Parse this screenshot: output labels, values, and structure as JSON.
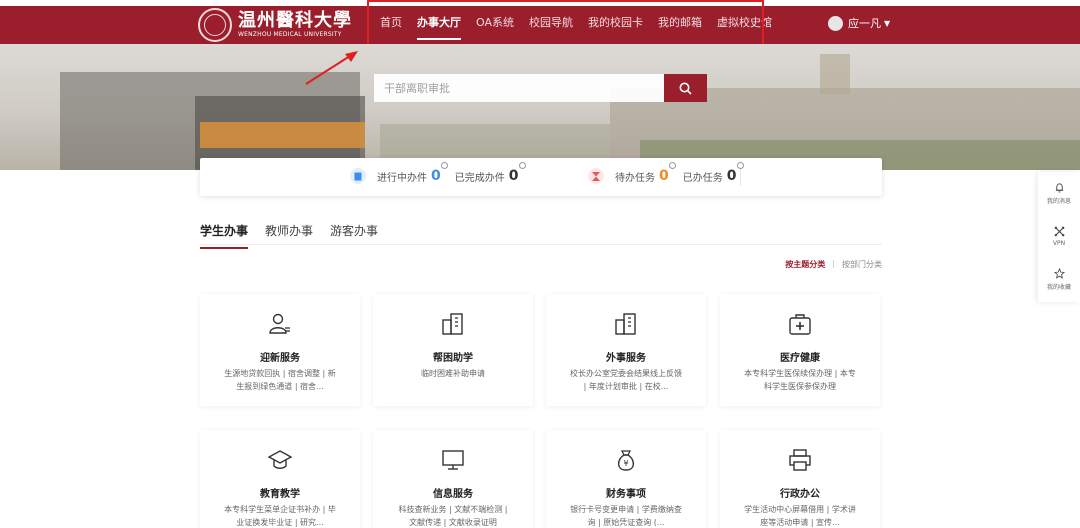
{
  "header": {
    "logo_cn": "温州醫科大學",
    "logo_en": "WENZHOU MEDICAL UNIVERSITY",
    "nav": [
      {
        "label": "首页",
        "active": false
      },
      {
        "label": "办事大厅",
        "active": true
      },
      {
        "label": "OA系统",
        "active": false
      },
      {
        "label": "校园导航",
        "active": false
      },
      {
        "label": "我的校园卡",
        "active": false
      },
      {
        "label": "我的邮箱",
        "active": false
      },
      {
        "label": "虚拟校史馆",
        "active": false
      }
    ],
    "user_name": "应一凡",
    "brand_color": "#9a1e2c"
  },
  "search": {
    "placeholder": "干部离职审批",
    "icon": "search-icon"
  },
  "stats": {
    "left": [
      {
        "label": "进行中办件",
        "count": "0"
      },
      {
        "label": "已完成办件",
        "count": "0"
      }
    ],
    "right": [
      {
        "label": "待办任务",
        "count": "0"
      },
      {
        "label": "已办任务",
        "count": "0"
      }
    ]
  },
  "tabs": [
    {
      "label": "学生办事",
      "active": true
    },
    {
      "label": "教师办事",
      "active": false
    },
    {
      "label": "游客办事",
      "active": false
    }
  ],
  "sort": {
    "by_topic": "按主题分类",
    "by_dept": "按部门分类"
  },
  "cards": [
    {
      "title": "迎新服务",
      "desc": "生源地贷款回执 | 宿舍调整 | 新生报到绿色通道 | 宿舍...",
      "icon": "user-card-icon"
    },
    {
      "title": "帮困助学",
      "desc": "临时困难补助申请",
      "icon": "building-icon"
    },
    {
      "title": "外事服务",
      "desc": "校长办公室党委会结果线上反馈 | 年度计划审批 | 在校...",
      "icon": "building-icon"
    },
    {
      "title": "医疗健康",
      "desc": "本专科学生医保续保办理 | 本专科学生医保参保办理",
      "icon": "medical-kit-icon"
    },
    {
      "title": "教育教学",
      "desc": "本专科学生菜单企证书补办 | 毕业证换发毕业证 | 研究...",
      "icon": "graduation-cap-icon"
    },
    {
      "title": "信息服务",
      "desc": "科技查新业务 | 文献不端检测 | 文献传递 | 文献收录证明",
      "icon": "monitor-icon"
    },
    {
      "title": "财务事项",
      "desc": "银行卡号变更申请 | 学费缴纳查询 | 原始凭证查询 (...",
      "icon": "money-bag-icon"
    },
    {
      "title": "行政办公",
      "desc": "学生活动中心屏幕借用 | 学术讲座等活动申请 | 宣传...",
      "icon": "printer-icon"
    }
  ],
  "float_bar": [
    {
      "label": "我的消息",
      "icon": "bell-icon"
    },
    {
      "label": "VPN",
      "icon": "vpn-icon"
    },
    {
      "label": "我的收藏",
      "icon": "star-icon"
    }
  ],
  "colors": {
    "accent": "#9a1e2c",
    "stat_blue": "#3f8ee6",
    "stat_orange": "#f08a24",
    "annotation_red": "#e02020"
  }
}
